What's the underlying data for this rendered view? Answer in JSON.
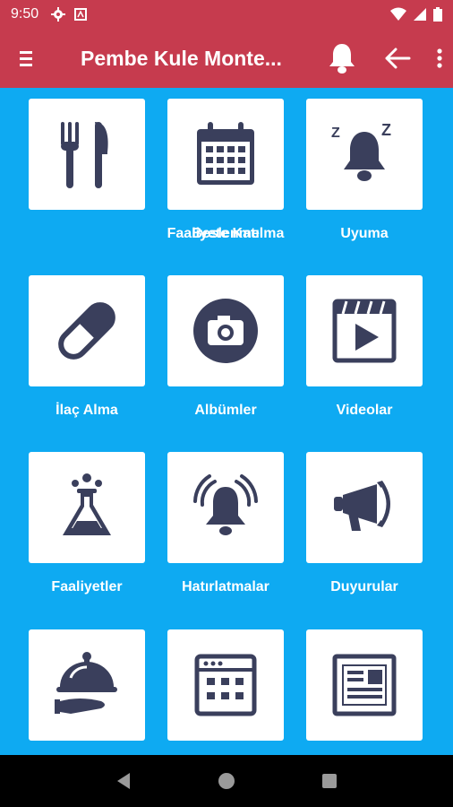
{
  "status": {
    "time": "9:50"
  },
  "app_bar": {
    "title": "Pembe Kule Monte..."
  },
  "tiles": [
    {
      "label": "Beslenme"
    },
    {
      "label": "Faaliyete Katılma"
    },
    {
      "label": "Uyuma"
    },
    {
      "label": "İlaç Alma"
    },
    {
      "label": "Albümler"
    },
    {
      "label": "Videolar"
    },
    {
      "label": "Faaliyetler"
    },
    {
      "label": "Hatırlatmalar"
    },
    {
      "label": "Duyurular"
    },
    {
      "label": ""
    },
    {
      "label": ""
    },
    {
      "label": ""
    }
  ],
  "colors": {
    "app_bar": "#c63b4e",
    "background": "#0eaaf2",
    "icon": "#3a3f5c"
  }
}
